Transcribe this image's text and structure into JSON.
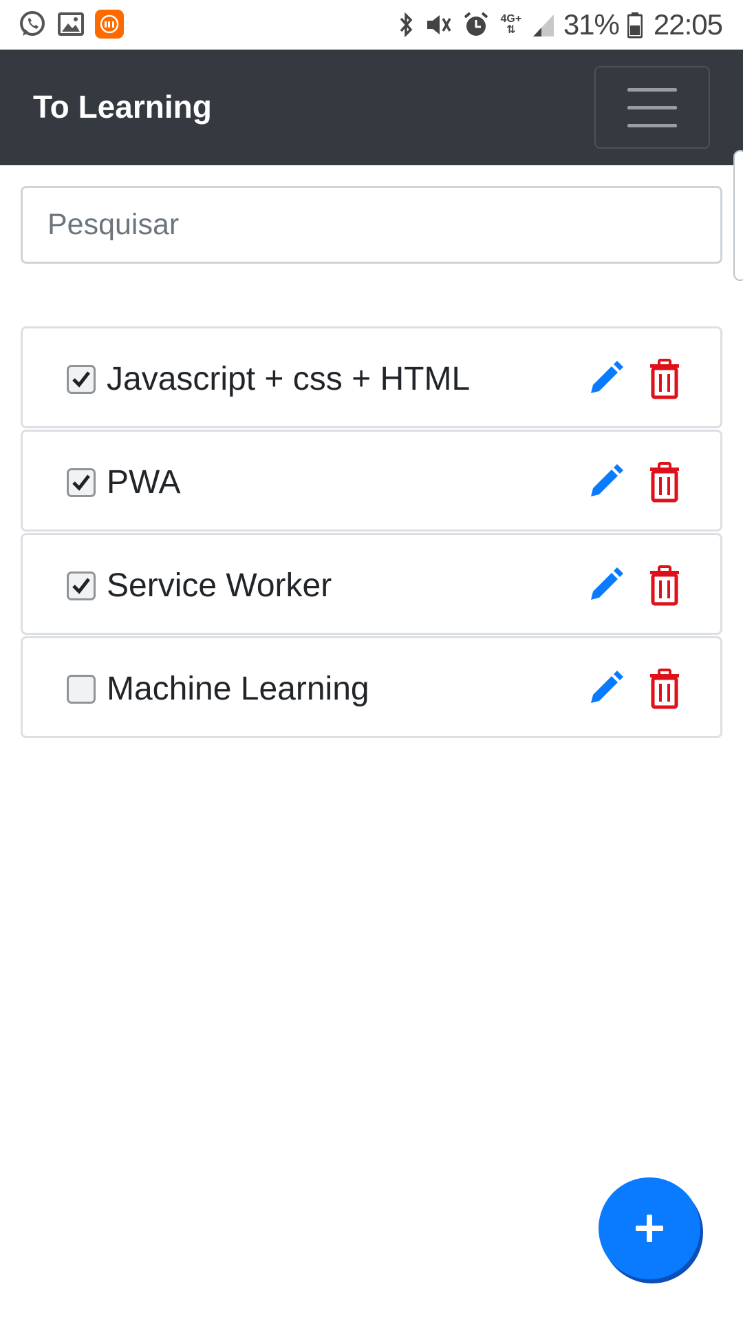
{
  "status_bar": {
    "left_icons": [
      "whatsapp-icon",
      "gallery-icon",
      "mi-icon"
    ],
    "right_icons": [
      "bluetooth-icon",
      "mute-icon",
      "alarm-icon",
      "network-4g-icon",
      "signal-icon",
      "battery-icon"
    ],
    "network_label": "4G+",
    "battery": "31%",
    "time": "22:05"
  },
  "navbar": {
    "brand": "To Learning",
    "menu_icon": "hamburger-icon",
    "background": "#343a40"
  },
  "search": {
    "placeholder": "Pesquisar",
    "value": ""
  },
  "items": [
    {
      "label": "Javascript + css + HTML",
      "checked": true
    },
    {
      "label": "PWA",
      "checked": true
    },
    {
      "label": "Service Worker",
      "checked": true
    },
    {
      "label": "Machine Learning",
      "checked": false
    }
  ],
  "actions": {
    "edit_icon": "pencil-icon",
    "delete_icon": "trash-icon",
    "edit_color": "#0a7bff",
    "delete_color": "#e0101a"
  },
  "fab": {
    "icon": "plus-icon",
    "color": "#0a7bff"
  }
}
